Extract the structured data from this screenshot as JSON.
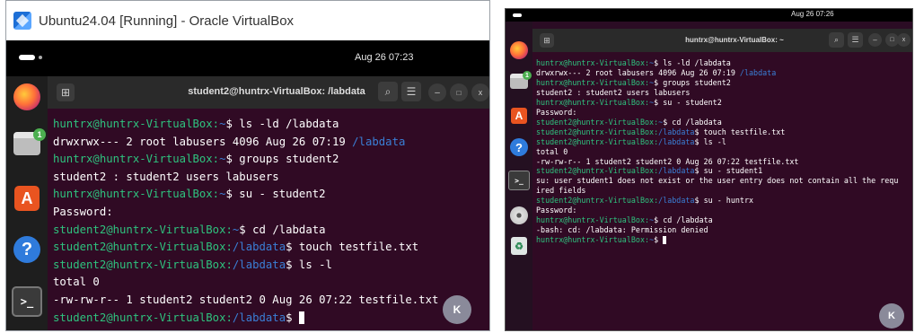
{
  "left": {
    "window_title": "Ubuntu24.04 [Running] - Oracle VirtualBox",
    "clock": "Aug 26 07:23",
    "terminal_title": "student2@huntrx-VirtualBox: /labdata",
    "dock_badge": "1",
    "k_badge": "K",
    "lines": [
      {
        "user": "huntrx@huntrx-VirtualBox:",
        "path": "~",
        "cmd": "$ ls -ld /labdata"
      },
      {
        "text": "drwxrwx--- 2 root labusers 4096 Aug 26 07:19 ",
        "dir": "/labdata"
      },
      {
        "user": "huntrx@huntrx-VirtualBox:",
        "path": "~",
        "cmd": "$ groups student2"
      },
      {
        "text": "student2 : student2 users labusers"
      },
      {
        "user": "huntrx@huntrx-VirtualBox:",
        "path": "~",
        "cmd": "$ su - student2"
      },
      {
        "text": "Password:"
      },
      {
        "user": "student2@huntrx-VirtualBox:",
        "path": "~",
        "cmd": "$ cd /labdata"
      },
      {
        "user": "student2@huntrx-VirtualBox:",
        "path": "/labdata",
        "cmd": "$ touch testfile.txt"
      },
      {
        "user": "student2@huntrx-VirtualBox:",
        "path": "/labdata",
        "cmd": "$ ls -l"
      },
      {
        "text": "total 0"
      },
      {
        "text": "-rw-rw-r-- 1 student2 student2 0 Aug 26 07:22 testfile.txt"
      },
      {
        "user": "student2@huntrx-VirtualBox:",
        "path": "/labdata",
        "cmd": "$ ",
        "cursor": true
      }
    ]
  },
  "right": {
    "clock": "Aug 26 07:26",
    "terminal_title": "huntrx@huntrx-VirtualBox: ~",
    "dock_badge": "1",
    "k_badge": "K",
    "lines": [
      {
        "user": "huntrx@huntrx-VirtualBox:",
        "path": "~",
        "cmd": "$ ls -ld /labdata"
      },
      {
        "text": "drwxrwx--- 2 root labusers 4096 Aug 26 07:19 ",
        "dir": "/labdata"
      },
      {
        "user": "huntrx@huntrx-VirtualBox:",
        "path": "~",
        "cmd": "$ groups student2"
      },
      {
        "text": "student2 : student2 users labusers"
      },
      {
        "user": "huntrx@huntrx-VirtualBox:",
        "path": "~",
        "cmd": "$ su - student2"
      },
      {
        "text": "Password:"
      },
      {
        "user": "student2@huntrx-VirtualBox:",
        "path": "~",
        "cmd": "$ cd /labdata"
      },
      {
        "user": "student2@huntrx-VirtualBox:",
        "path": "/labdata",
        "cmd": "$ touch testfile.txt"
      },
      {
        "user": "student2@huntrx-VirtualBox:",
        "path": "/labdata",
        "cmd": "$ ls -l"
      },
      {
        "text": "total 0"
      },
      {
        "text": "-rw-rw-r-- 1 student2 student2 0 Aug 26 07:22 testfile.txt"
      },
      {
        "user": "student2@huntrx-VirtualBox:",
        "path": "/labdata",
        "cmd": "$ su - student1"
      },
      {
        "text": "su: user student1 does not exist or the user entry does not contain all the requ"
      },
      {
        "text": "ired fields"
      },
      {
        "user": "student2@huntrx-VirtualBox:",
        "path": "/labdata",
        "cmd": "$ su - huntrx"
      },
      {
        "text": "Password:"
      },
      {
        "user": "huntrx@huntrx-VirtualBox:",
        "path": "~",
        "cmd": "$ cd /labdata"
      },
      {
        "text": "-bash: cd: /labdata: Permission denied"
      },
      {
        "user": "huntrx@huntrx-VirtualBox:",
        "path": "~",
        "cmd": "$ ",
        "cursor": true
      }
    ]
  },
  "colors": {
    "terminal_bg": "#300a24",
    "prompt_user": "#2ec27e",
    "prompt_path": "#3a7fd6",
    "text": "#ffffff"
  },
  "icons": {
    "dock": [
      "firefox-icon",
      "files-icon",
      "app-center-icon",
      "help-icon",
      "terminal-icon",
      "disc-icon",
      "trash-icon"
    ],
    "header": [
      "new-tab-icon",
      "search-icon",
      "hamburger-menu-icon",
      "minimize-icon",
      "maximize-icon",
      "close-icon"
    ]
  }
}
